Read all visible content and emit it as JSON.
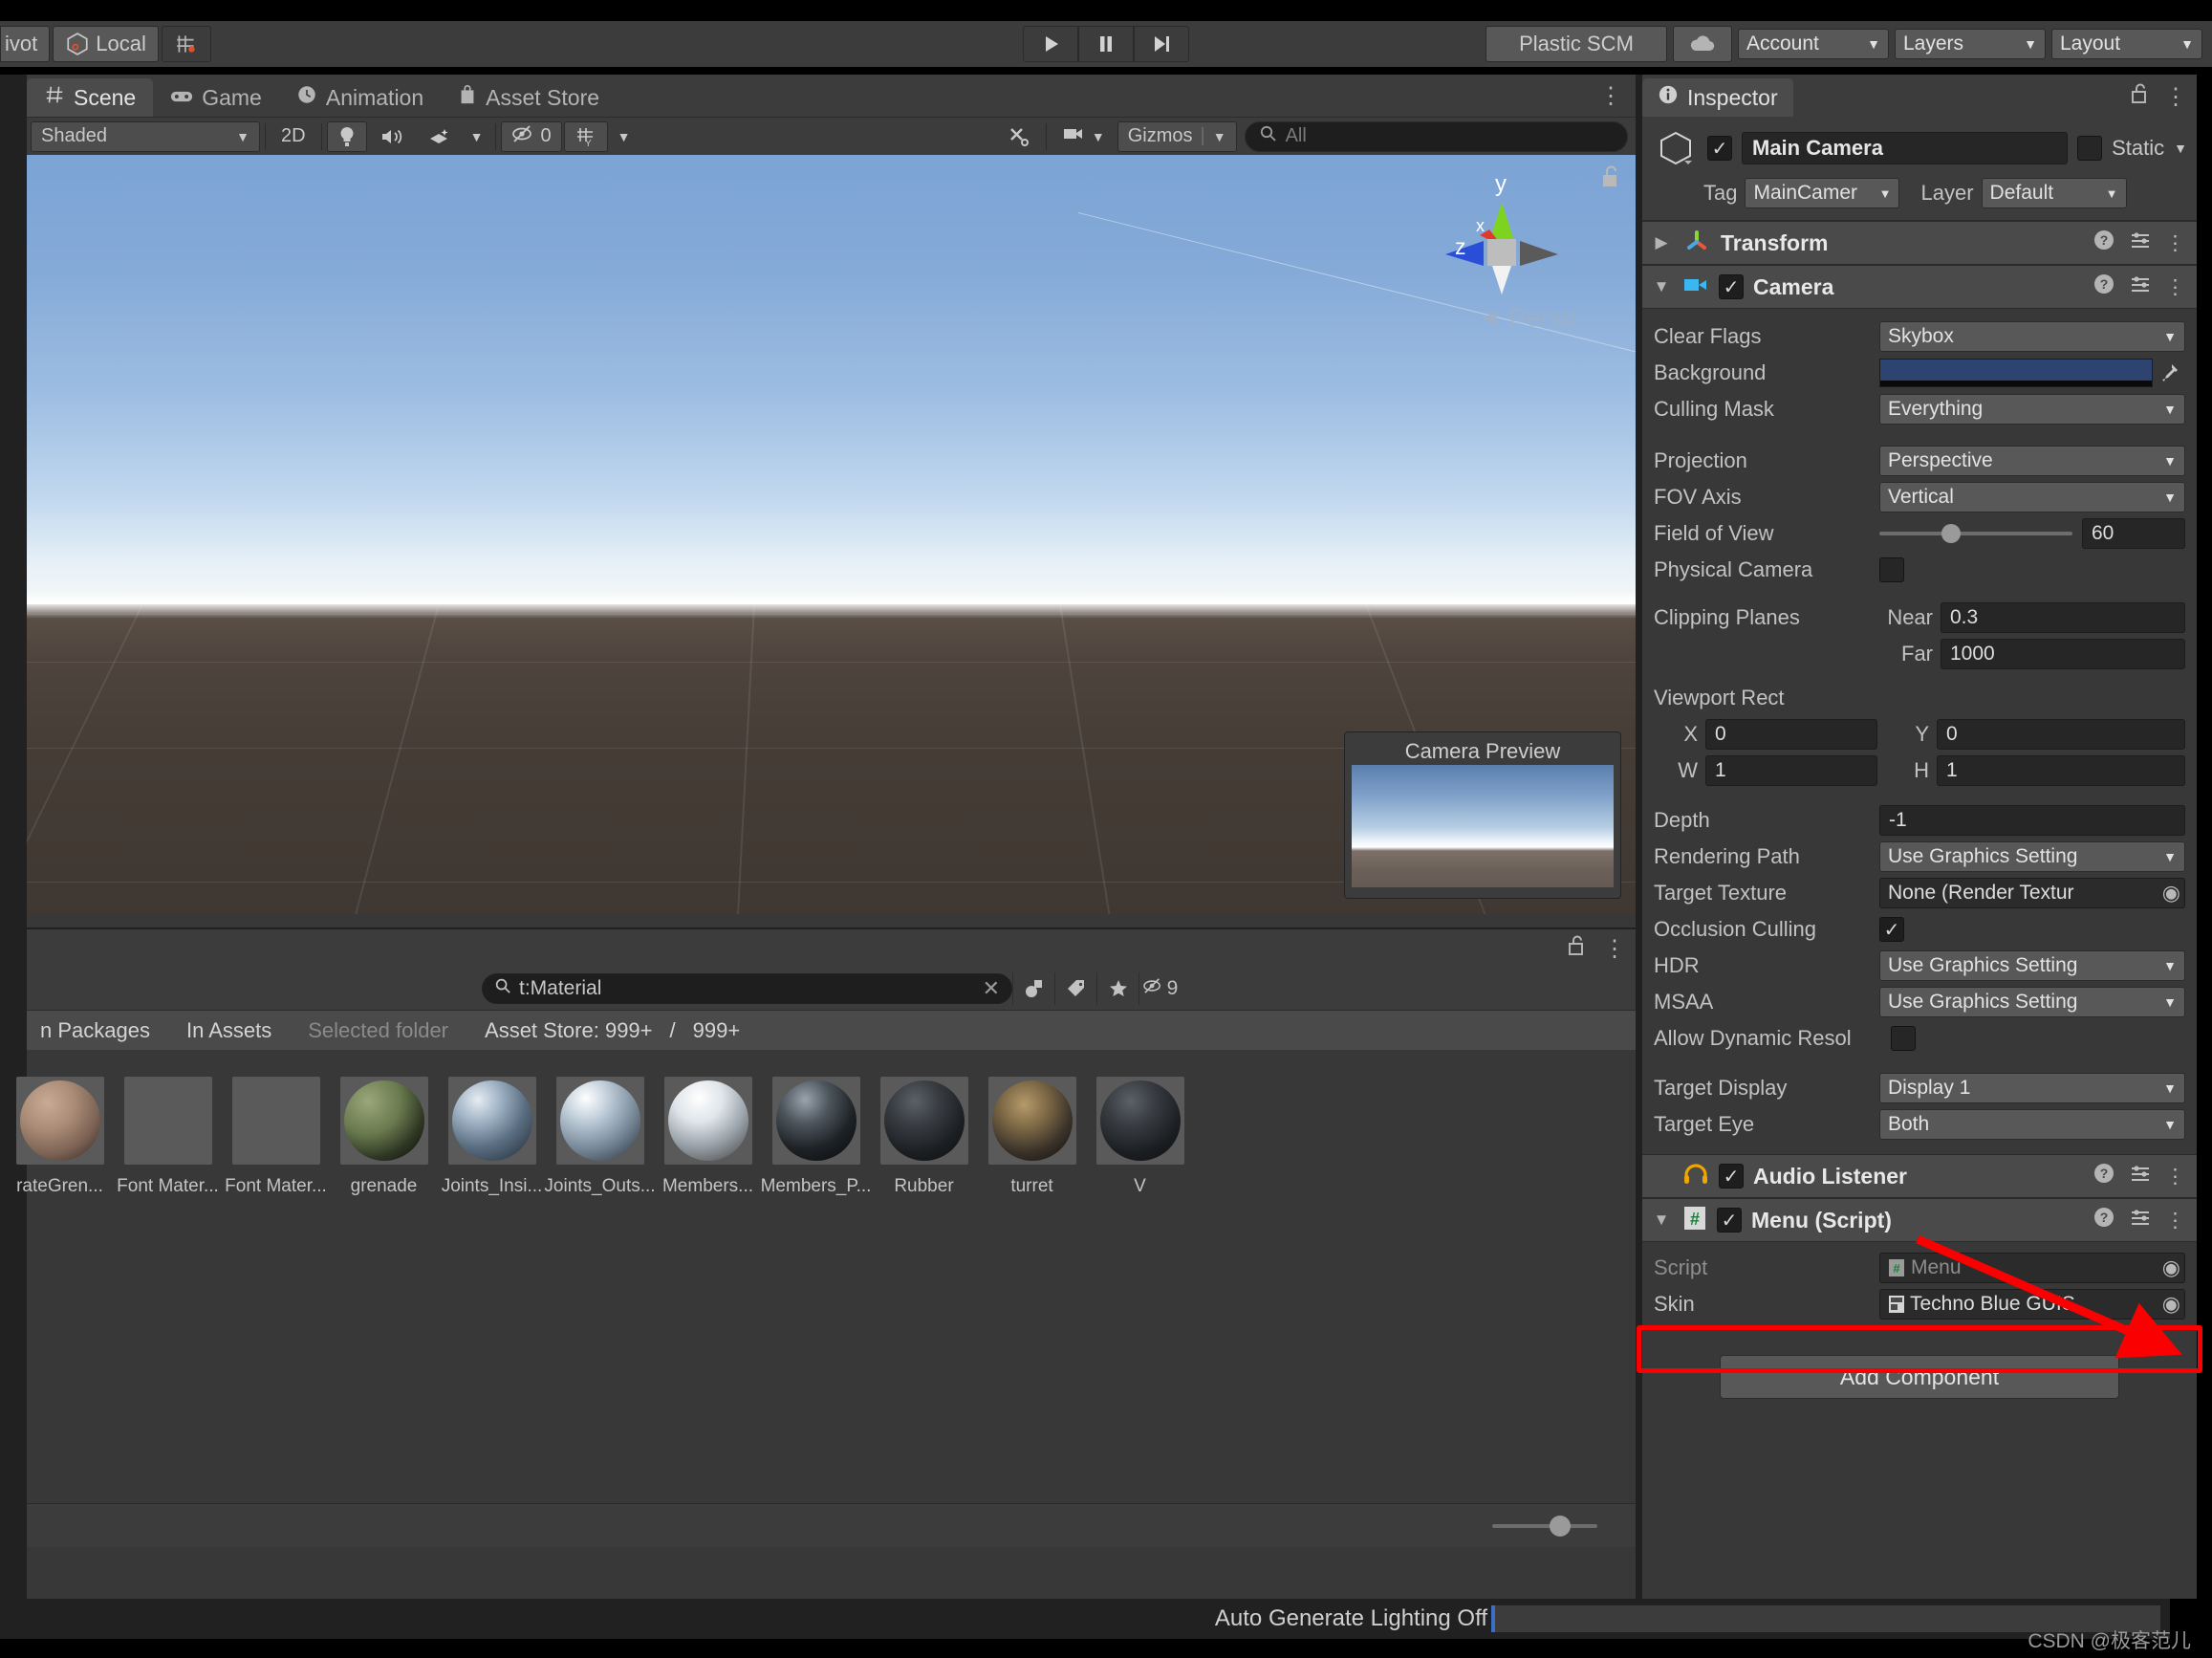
{
  "toolbar": {
    "pivot_label": "ivot",
    "local_label": "Local",
    "snap_icon": "grid-snap-icon",
    "play_icon": "play-icon",
    "pause_icon": "pause-icon",
    "step_icon": "step-icon",
    "plastic_scm": "Plastic SCM",
    "cloud_icon": "cloud-icon",
    "account": "Account",
    "layers": "Layers",
    "layout": "Layout",
    "caret": "▼"
  },
  "scene_panel": {
    "tabs": [
      {
        "label": "Scene",
        "icon": "hash-icon",
        "active": true
      },
      {
        "label": "Game",
        "icon": "gamepad-icon",
        "active": false
      },
      {
        "label": "Animation",
        "icon": "clock-icon",
        "active": false
      },
      {
        "label": "Asset Store",
        "icon": "shop-bag-icon",
        "active": false
      }
    ],
    "menu_icon": "kebab-menu-icon",
    "toolbar": {
      "draw_mode": "Shaded",
      "two_d": "2D",
      "lighting_icon": "lightbulb-icon",
      "audio_icon": "speaker-icon",
      "fx_icon": "effects-icon",
      "hidden_objects_count": "0",
      "hidden_icon": "eye-off-icon",
      "grid_icon": "grid-y-icon",
      "tools_icon": "tools-icon",
      "camera_icon": "camera-icon",
      "gizmos": "Gizmos",
      "search_placeholder": "All",
      "search_icon": "search-icon"
    },
    "gizmo": {
      "y_label": "y",
      "x_label": "x",
      "z_label": "z",
      "persp_label": "Persp",
      "persp_arrow": "◄",
      "lock_icon": "lock-open-icon"
    },
    "camera_preview": {
      "title": "Camera Preview"
    }
  },
  "project_panel": {
    "lock_icon": "lock-open-icon",
    "menu_icon": "kebab-menu-icon",
    "search": {
      "value": "t:Material",
      "icon": "search-icon",
      "clear_icon": "clear-x-icon"
    },
    "filters": [
      {
        "name": "filter-by-type",
        "icon": "type-filter-icon",
        "label": ""
      },
      {
        "name": "filter-by-label",
        "icon": "tag-icon",
        "label": ""
      },
      {
        "name": "filter-favorites",
        "icon": "star-icon",
        "label": ""
      },
      {
        "name": "hidden-count",
        "icon": "eye-off-icon",
        "label": "9"
      }
    ],
    "breadcrumbs": [
      {
        "label": "n Packages",
        "dim": false
      },
      {
        "label": "In Assets",
        "dim": false
      },
      {
        "label": "Selected folder",
        "dim": true
      },
      {
        "label": "Asset Store: 999+",
        "dim": false
      },
      {
        "label": "/",
        "dim": false
      },
      {
        "label": "999+",
        "dim": false
      }
    ],
    "assets": [
      {
        "label": "rateGren...",
        "sphere": "wood-brown"
      },
      {
        "label": "Font Mater...",
        "sphere": "none"
      },
      {
        "label": "Font Mater...",
        "sphere": "none"
      },
      {
        "label": "grenade",
        "sphere": "green-dark"
      },
      {
        "label": "Joints_Insi...",
        "sphere": "steel-blue"
      },
      {
        "label": "Joints_Outs...",
        "sphere": "steel-light"
      },
      {
        "label": "Members...",
        "sphere": "chrome"
      },
      {
        "label": "Members_P...",
        "sphere": "black-chrome"
      },
      {
        "label": "Rubber",
        "sphere": "rubber-black"
      },
      {
        "label": "turret",
        "sphere": "rust-gold"
      },
      {
        "label": "V",
        "sphere": "rubber-black"
      }
    ]
  },
  "inspector": {
    "tab_label": "Inspector",
    "tab_icon": "info-icon",
    "lock_icon": "lock-open-icon",
    "menu_icon": "kebab-menu-icon",
    "object": {
      "enabled": true,
      "name": "Main Camera",
      "static_label": "Static",
      "static_checked": false,
      "tag_label": "Tag",
      "tag_value": "MainCamer",
      "layer_label": "Layer",
      "layer_value": "Default",
      "prefab_icon": "cube-icon"
    },
    "components": [
      {
        "name": "Transform",
        "icon": "transform-axes-icon",
        "expanded": false,
        "has_checkbox": false
      },
      {
        "name": "Camera",
        "icon": "camera-icon",
        "expanded": true,
        "has_checkbox": true,
        "enabled": true
      }
    ],
    "camera_props": {
      "clear_flags": {
        "label": "Clear Flags",
        "value": "Skybox"
      },
      "background": {
        "label": "Background",
        "color": "#2d4470",
        "eyedropper_icon": "eyedropper-icon"
      },
      "culling_mask": {
        "label": "Culling Mask",
        "value": "Everything"
      },
      "projection": {
        "label": "Projection",
        "value": "Perspective"
      },
      "fov_axis": {
        "label": "FOV Axis",
        "value": "Vertical"
      },
      "field_of_view": {
        "label": "Field of View",
        "value": "60"
      },
      "physical_camera": {
        "label": "Physical Camera",
        "checked": false
      },
      "clipping_planes": {
        "label": "Clipping Planes",
        "near_label": "Near",
        "near": "0.3",
        "far_label": "Far",
        "far": "1000"
      },
      "viewport_rect": {
        "label": "Viewport Rect",
        "x_label": "X",
        "x": "0",
        "y_label": "Y",
        "y": "0",
        "w_label": "W",
        "w": "1",
        "h_label": "H",
        "h": "1"
      },
      "depth": {
        "label": "Depth",
        "value": "-1"
      },
      "rendering_path": {
        "label": "Rendering Path",
        "value": "Use Graphics Setting"
      },
      "target_texture": {
        "label": "Target Texture",
        "value": "None (Render Textur"
      },
      "occlusion_culling": {
        "label": "Occlusion Culling",
        "checked": true
      },
      "hdr": {
        "label": "HDR",
        "value": "Use Graphics Setting"
      },
      "msaa": {
        "label": "MSAA",
        "value": "Use Graphics Setting"
      },
      "allow_dynamic_resolution": {
        "label": "Allow Dynamic Resol",
        "checked": false
      },
      "target_display": {
        "label": "Target Display",
        "value": "Display 1"
      },
      "target_eye": {
        "label": "Target Eye",
        "value": "Both"
      }
    },
    "audio_listener": {
      "name": "Audio Listener",
      "icon": "headphones-icon",
      "enabled": true
    },
    "menu_script": {
      "name": "Menu (Script)",
      "icon": "csharp-script-icon",
      "enabled": true,
      "expanded": true,
      "script_label": "Script",
      "script_value": "Menu",
      "skin_label": "Skin",
      "skin_value": "Techno Blue GUIS",
      "object_picker_icon": "object-picker-icon"
    },
    "add_component": "Add Component",
    "annotation": {
      "highlight_color": "#fb0000",
      "arrow_color": "#fb0000"
    }
  },
  "status_bar": {
    "message": "Auto Generate Lighting Off",
    "accent": "#3b6fc4",
    "watermark": "CSDN @极客范儿"
  }
}
